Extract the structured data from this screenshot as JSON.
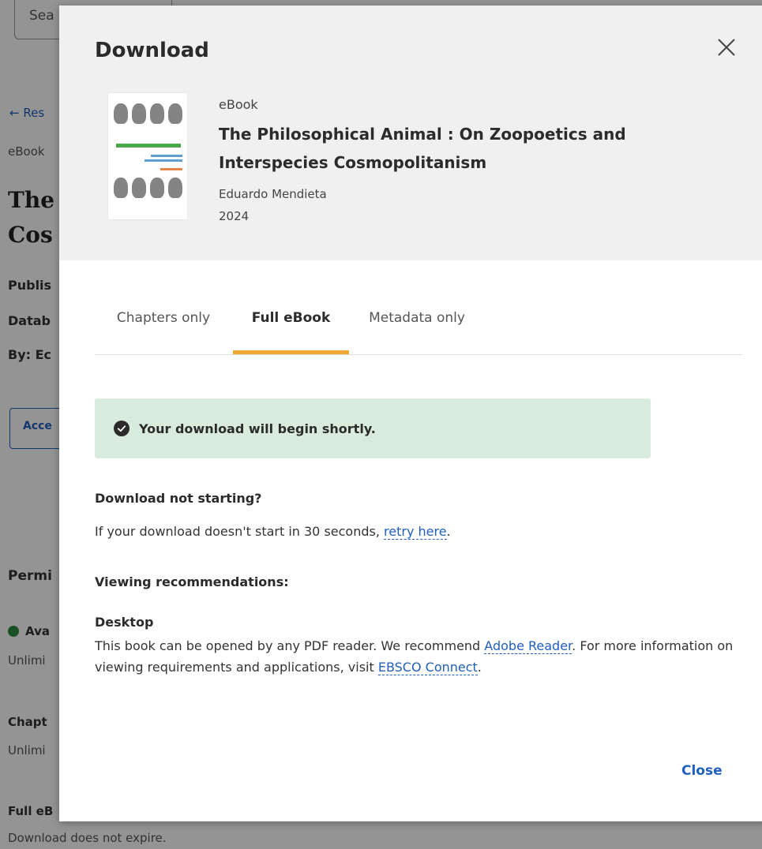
{
  "background": {
    "search_placeholder": "Sea",
    "back_link": "← Res",
    "type": "eBook",
    "title_line1": "The",
    "title_line2": "Cos",
    "publisher": "Publis",
    "database": "Datab",
    "by": "By: Ec",
    "access_button": "Acce",
    "permissions_heading": "Permi",
    "available": "Ava",
    "unlimited_1": "Unlimi",
    "chapter_heading": "Chapt",
    "unlimited_2": "Unlimi",
    "full_ebook_heading": "Full eB",
    "download_expire": "Download does not expire."
  },
  "modal": {
    "title": "Download",
    "book": {
      "type": "eBook",
      "title": "The Philosophical Animal : On Zoopoetics and Interspecies Cosmopolitanism",
      "author": "Eduardo Mendieta",
      "year": "2024"
    },
    "tabs": [
      {
        "label": "Chapters only",
        "active": false
      },
      {
        "label": "Full eBook",
        "active": true
      },
      {
        "label": "Metadata only",
        "active": false
      }
    ],
    "alert": {
      "text": "Your download will begin shortly."
    },
    "not_starting": {
      "heading": "Download not starting?",
      "text_before": "If your download doesn't start in 30 seconds, ",
      "link": "retry here",
      "text_after": "."
    },
    "viewing": {
      "heading": "Viewing recommendations:",
      "desktop_heading": "Desktop",
      "text_1": "This book can be opened by any PDF reader. We recommend ",
      "link_1": "Adobe Reader",
      "text_2": ". For more information on viewing requirements and applications, visit ",
      "link_2": "EBSCO Connect",
      "text_3": "."
    },
    "close_label": "Close"
  },
  "colors": {
    "accent_link": "#1f5fbf",
    "tab_underline": "#f0a832",
    "alert_bg": "#d9ebdd",
    "header_bg": "#f0f0f0"
  },
  "icons": {
    "close": "close-icon",
    "check": "check-circle-icon",
    "back": "arrow-left-icon"
  }
}
